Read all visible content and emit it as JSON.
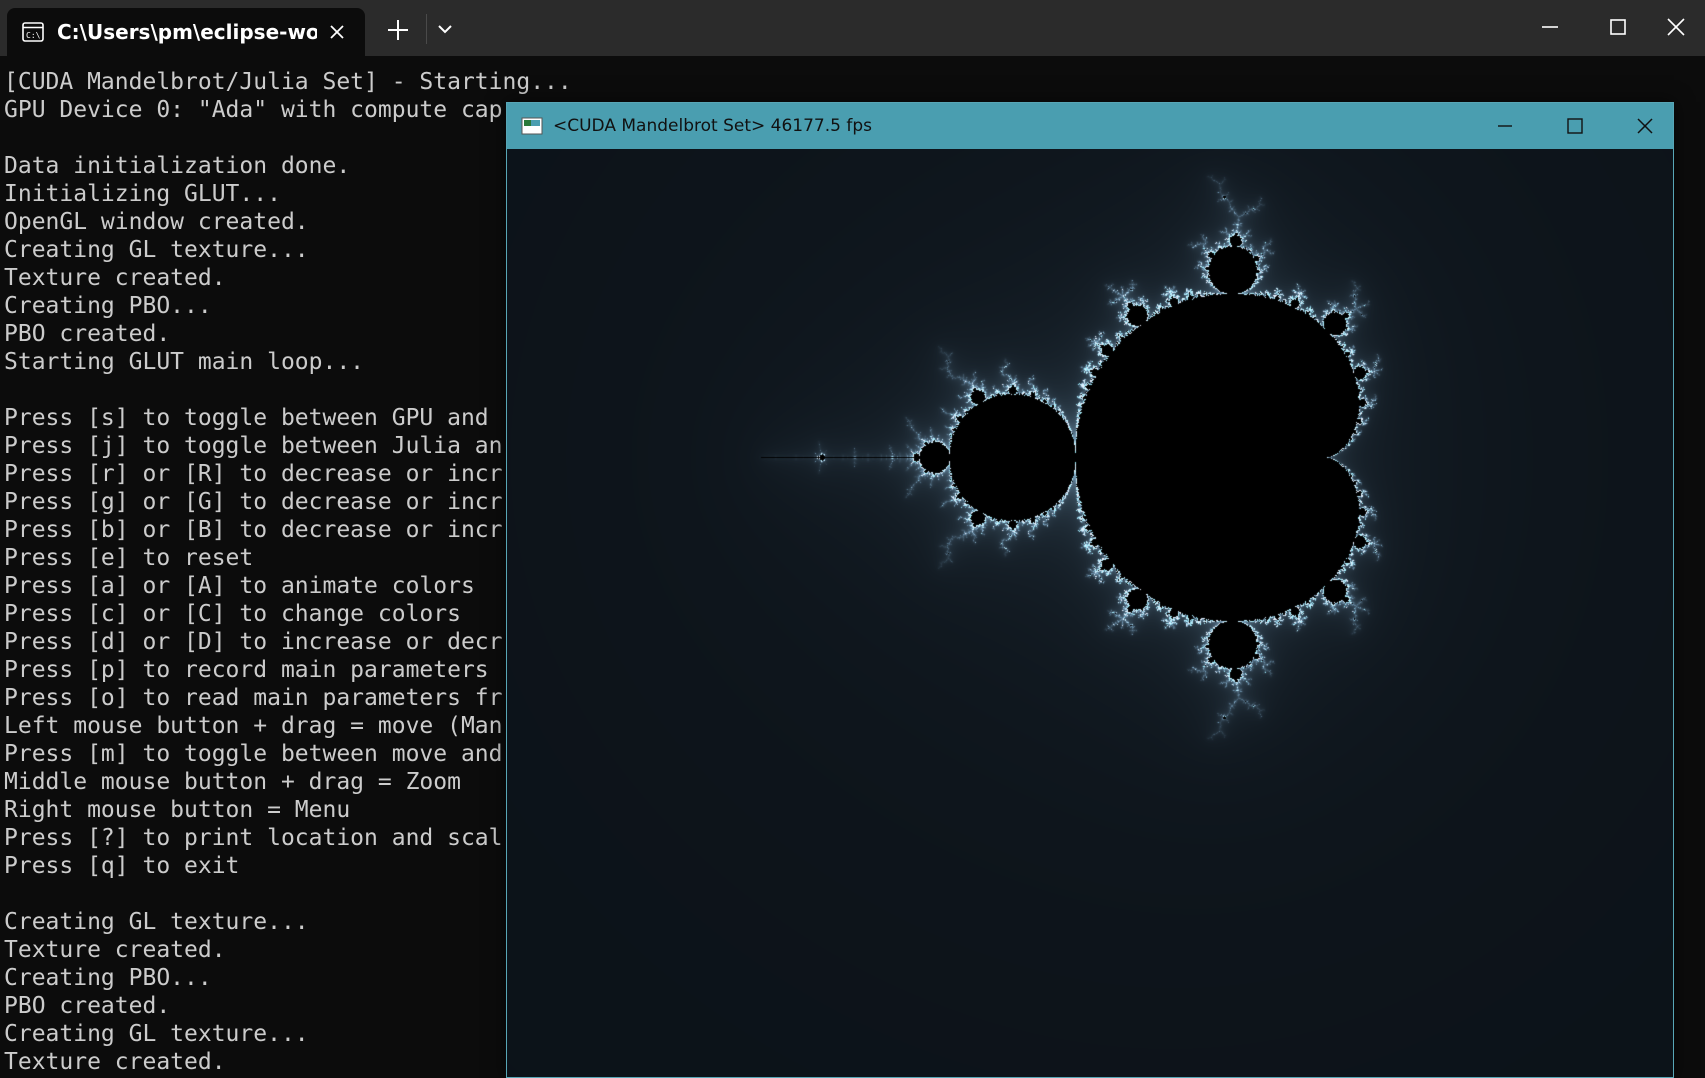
{
  "terminal": {
    "tab_title": "C:\\Users\\pm\\eclipse-wo",
    "icons": {
      "tab": "terminal-icon",
      "close_tab": "close-icon",
      "new_tab": "plus-icon",
      "dropdown": "chevron-down-icon",
      "minimize": "minimize-icon",
      "maximize": "maximize-icon",
      "close": "close-icon"
    },
    "lines": [
      "[CUDA Mandelbrot/Julia Set] - Starting...",
      "GPU Device 0: \"Ada\" with compute cap",
      "",
      "Data initialization done.",
      "Initializing GLUT...",
      "OpenGL window created.",
      "Creating GL texture...",
      "Texture created.",
      "Creating PBO...",
      "PBO created.",
      "Starting GLUT main loop...",
      "",
      "Press [s] to toggle between GPU and",
      "Press [j] to toggle between Julia an",
      "Press [r] or [R] to decrease or incr",
      "Press [g] or [G] to decrease or incr",
      "Press [b] or [B] to decrease or incr",
      "Press [e] to reset",
      "Press [a] or [A] to animate colors",
      "Press [c] or [C] to change colors",
      "Press [d] or [D] to increase or decr",
      "Press [p] to record main parameters",
      "Press [o] to read main parameters fr",
      "Left mouse button + drag = move (Man",
      "Press [m] to toggle between move and",
      "Middle mouse button + drag = Zoom",
      "Right mouse button = Menu",
      "Press [?] to print location and scal",
      "Press [q] to exit",
      "",
      "Creating GL texture...",
      "Texture created.",
      "Creating PBO...",
      "PBO created.",
      "Creating GL texture...",
      "Texture created."
    ]
  },
  "glut_window": {
    "title": "<CUDA Mandelbrot Set> 46177.5 fps",
    "icons": {
      "app": "window-icon",
      "minimize": "minimize-icon",
      "maximize": "maximize-icon",
      "close": "close-icon"
    },
    "fractal": "mandelbrot-set"
  },
  "colors": {
    "terminal_bg": "#0c0c0c",
    "terminal_text": "#cccccc",
    "titlebar_bg": "#2b2b2b",
    "glut_title_bg": "#4a9eb0",
    "fractal_interior": "#000000",
    "fractal_edge": "#8ec8e8"
  }
}
